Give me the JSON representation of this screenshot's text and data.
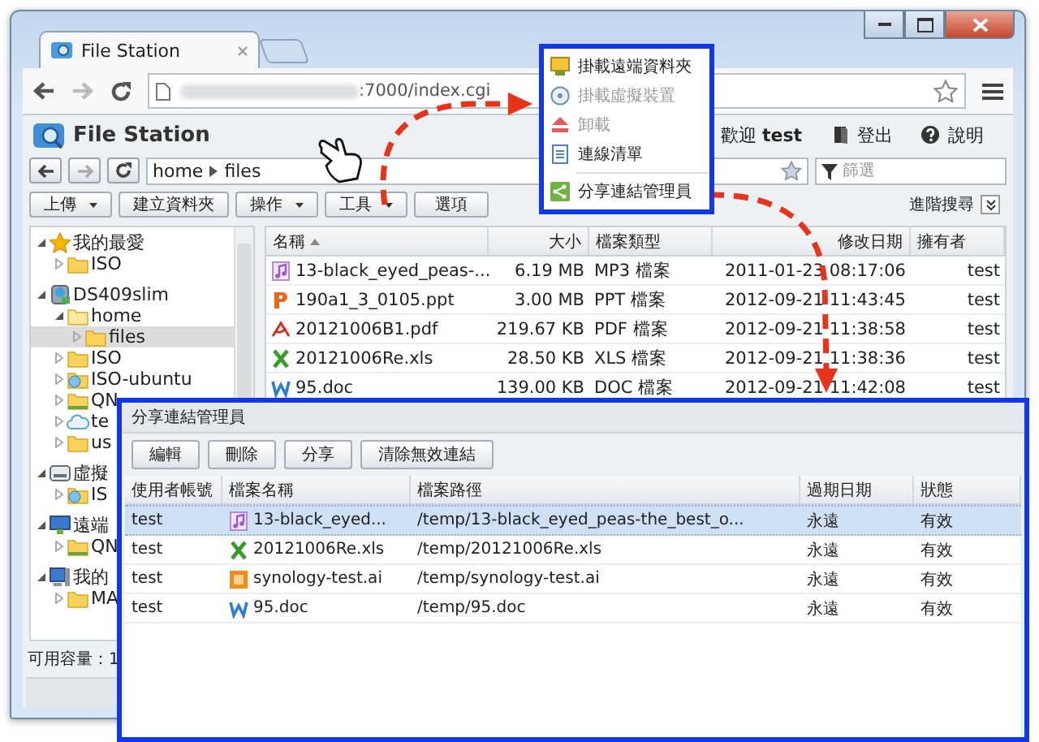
{
  "browser": {
    "tab_title": "File Station",
    "url": ":7000/index.cgi"
  },
  "app": {
    "title": "File Station",
    "welcome": "歡迎",
    "user": "test",
    "logout": "登出",
    "help": "說明"
  },
  "path": [
    "home",
    "files"
  ],
  "filter": {
    "placeholder": "篩選"
  },
  "toolbar": [
    {
      "label": "上傳",
      "dropdown": true
    },
    {
      "label": "建立資料夾",
      "dropdown": false
    },
    {
      "label": "操作",
      "dropdown": true
    },
    {
      "label": "工具",
      "dropdown": true
    },
    {
      "label": "選項",
      "dropdown": false
    }
  ],
  "advanced_search": "進階搜尋",
  "tree": [
    {
      "label": "我的最愛",
      "kind": "star",
      "expanded": true,
      "selected": false,
      "children": [
        {
          "label": "ISO",
          "kind": "folder",
          "expanded": false,
          "selected": false
        }
      ]
    },
    {
      "label": "DS409slim",
      "kind": "nas",
      "expanded": true,
      "selected": false,
      "children": [
        {
          "label": "home",
          "kind": "folder-open",
          "expanded": true,
          "selected": false,
          "children": [
            {
              "label": "files",
              "kind": "folder",
              "expanded": false,
              "selected": true
            }
          ]
        },
        {
          "label": "ISO",
          "kind": "folder",
          "expanded": false,
          "selected": false
        },
        {
          "label": "ISO-ubuntu",
          "kind": "folder-globe",
          "expanded": false,
          "selected": false
        },
        {
          "label": "QN",
          "kind": "folder-shared",
          "expanded": false,
          "selected": false
        },
        {
          "label": "te",
          "kind": "cloud",
          "expanded": false,
          "selected": false
        },
        {
          "label": "us",
          "kind": "folder",
          "expanded": false,
          "selected": false
        }
      ]
    },
    {
      "label": "虛擬",
      "kind": "drive",
      "expanded": true,
      "selected": false,
      "children": [
        {
          "label": "IS",
          "kind": "folder-globe",
          "expanded": false,
          "selected": false
        }
      ]
    },
    {
      "label": "遠端",
      "kind": "monitor",
      "expanded": true,
      "selected": false,
      "children": [
        {
          "label": "QN",
          "kind": "folder-shared",
          "expanded": false,
          "selected": false
        }
      ]
    },
    {
      "label": "我的",
      "kind": "computer",
      "expanded": true,
      "selected": false,
      "children": [
        {
          "label": "MA",
          "kind": "folder",
          "expanded": false,
          "selected": false
        }
      ]
    }
  ],
  "free_space": "可用容量：1",
  "files": {
    "columns": [
      "名稱",
      "大小",
      "檔案類型",
      "修改日期",
      "擁有者"
    ],
    "rows": [
      {
        "kind": "audio",
        "name": "13-black_eyed_peas-...",
        "size": "6.19 MB",
        "type": "MP3 檔案",
        "modified": "2011-01-23 08:17:06",
        "owner": "test"
      },
      {
        "kind": "slides",
        "name": "190a1_3_0105.ppt",
        "size": "3.00 MB",
        "type": "PPT 檔案",
        "modified": "2012-09-21 11:43:45",
        "owner": "test"
      },
      {
        "kind": "pdf",
        "name": "20121006B1.pdf",
        "size": "219.67 KB",
        "type": "PDF 檔案",
        "modified": "2012-09-21 11:38:58",
        "owner": "test"
      },
      {
        "kind": "sheet",
        "name": "20121006Re.xls",
        "size": "28.50 KB",
        "type": "XLS 檔案",
        "modified": "2012-09-21 11:38:36",
        "owner": "test"
      },
      {
        "kind": "doc",
        "name": "95.doc",
        "size": "139.00 KB",
        "type": "DOC 檔案",
        "modified": "2012-09-21 11:42:08",
        "owner": "test"
      }
    ]
  },
  "tools_menu": [
    {
      "label": "掛載遠端資料夾",
      "kind": "monitor",
      "disabled": false
    },
    {
      "label": "掛載虛擬裝置",
      "kind": "disc",
      "disabled": true
    },
    {
      "label": "卸載",
      "kind": "eject",
      "disabled": true
    },
    {
      "label": "連線清單",
      "kind": "list",
      "disabled": false
    },
    {
      "label": "分享連結管理員",
      "kind": "share",
      "disabled": false
    }
  ],
  "share_dialog": {
    "title": "分享連結管理員",
    "buttons": [
      "編輯",
      "刪除",
      "分享",
      "清除無效連結"
    ],
    "columns": [
      "使用者帳號",
      "檔案名稱",
      "檔案路徑",
      "過期日期",
      "狀態"
    ],
    "rows": [
      {
        "user": "test",
        "kind": "audio",
        "file": "13-black_eyed...",
        "path": "/temp/13-black_eyed_peas-the_best_o...",
        "expires": "永遠",
        "status": "有效",
        "selected": true
      },
      {
        "user": "test",
        "kind": "sheet",
        "file": "20121006Re.xls",
        "path": "/temp/20121006Re.xls",
        "expires": "永遠",
        "status": "有效",
        "selected": false
      },
      {
        "user": "test",
        "kind": "image",
        "file": "synology-test.ai",
        "path": "/temp/synology-test.ai",
        "expires": "永遠",
        "status": "有效",
        "selected": false
      },
      {
        "user": "test",
        "kind": "doc",
        "file": "95.doc",
        "path": "/temp/95.doc",
        "expires": "永遠",
        "status": "有效",
        "selected": false
      }
    ]
  }
}
